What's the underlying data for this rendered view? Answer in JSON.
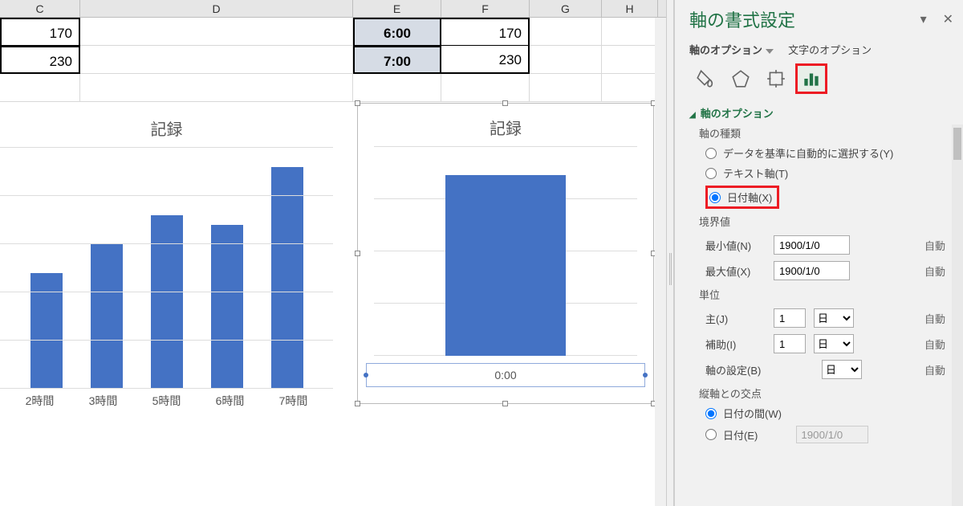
{
  "columns": {
    "C": "C",
    "D": "D",
    "E": "E",
    "F": "F",
    "G": "G",
    "H": "H"
  },
  "cells": {
    "c1": "170",
    "e1": "6:00",
    "f1": "170",
    "c2": "230",
    "e2": "7:00",
    "f2": "230"
  },
  "chart_left": {
    "title": "記録",
    "categories": [
      "2時間",
      "3時間",
      "5時間",
      "6時間",
      "7時間"
    ],
    "values": [
      120,
      150,
      180,
      170,
      230
    ]
  },
  "chart_right": {
    "title": "記録",
    "xlabel": "0:00"
  },
  "chart_data": [
    {
      "type": "bar",
      "title": "記録",
      "categories": [
        "2時間",
        "3時間",
        "5時間",
        "6時間",
        "7時間"
      ],
      "values": [
        120,
        150,
        180,
        170,
        230
      ],
      "ylim": [
        0,
        250
      ]
    },
    {
      "type": "bar",
      "title": "記録",
      "categories": [
        "0:00"
      ],
      "values": [
        230
      ],
      "ylim": [
        0,
        250
      ],
      "note": "single merged bar after axis type changed to date axis"
    }
  ],
  "pane": {
    "title": "軸の書式設定",
    "tab_axis_options": "軸のオプション",
    "tab_text_options": "文字のオプション",
    "section_axis_options": "軸のオプション",
    "axis_type_label": "軸の種類",
    "radio_auto": "データを基準に自動的に選択する(Y)",
    "radio_text": "テキスト軸(T)",
    "radio_date": "日付軸(X)",
    "bounds_label": "境界値",
    "min_label": "最小値(N)",
    "min_value": "1900/1/0",
    "min_auto": "自動",
    "max_label": "最大値(X)",
    "max_value": "1900/1/0",
    "max_auto": "自動",
    "units_label": "単位",
    "major_label": "主(J)",
    "major_value": "1",
    "major_unit_opt": "日",
    "major_auto": "自動",
    "minor_label": "補助(I)",
    "minor_value": "1",
    "minor_unit_opt": "日",
    "minor_auto": "自動",
    "axis_setting_label": "軸の設定(B)",
    "axis_setting_opt": "日",
    "axis_setting_auto": "自動",
    "cross_label": "縦軸との交点",
    "cross_between": "日付の間(W)",
    "cross_date": "日付(E)",
    "cross_date_value": "1900/1/0"
  },
  "underline": {
    "Y": "Y",
    "T": "T",
    "X": "X",
    "N": "N",
    "J": "J",
    "I": "I",
    "B": "B",
    "W": "W",
    "E": "E"
  }
}
